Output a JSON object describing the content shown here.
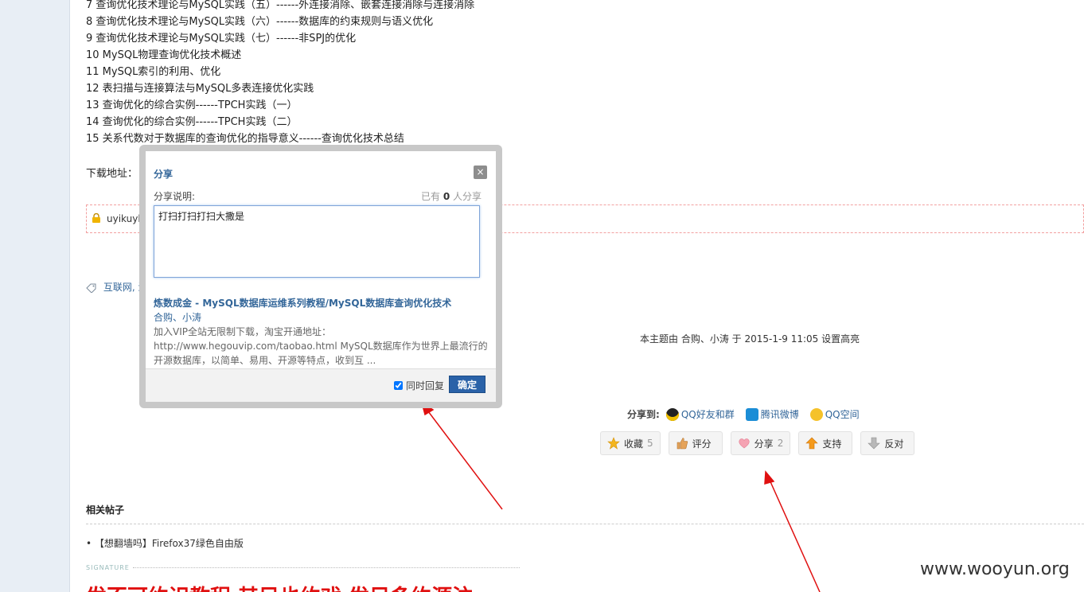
{
  "toc": [
    "7 查询优化技术理论与MySQL实践（五）------外连接消除、嵌套连接消除与连接消除",
    "8 查询优化技术理论与MySQL实践（六）------数据库的约束规则与语义优化",
    "9 查询优化技术理论与MySQL实践（七）------非SPJ的优化",
    "10 MySQL物理查询优化技术概述",
    "11 MySQL索引的利用、优化",
    "12 表扫描与连接算法与MySQL多表连接优化实践",
    "13 查询优化的综合实例------TPCH实践（一）",
    "14 查询优化的综合实例------TPCH实践（二）",
    "15 关系代数对于数据库的查询优化的指导意义------查询优化技术总结"
  ],
  "download_label": "下载地址：",
  "locked_text": "uyikuyk ,",
  "tags_text": "互联网, 淘",
  "highlight_note": "本主题由 合购、小涛 于 2015-1-9 11:05 设置高亮",
  "share_to": {
    "label": "分享到:",
    "links": [
      "QQ好友和群",
      "腾讯微博",
      "QQ空间"
    ]
  },
  "actions": [
    {
      "label": "收藏",
      "count": "5"
    },
    {
      "label": "评分",
      "count": ""
    },
    {
      "label": "分享",
      "count": "2"
    },
    {
      "label": "支持",
      "count": ""
    },
    {
      "label": "反对",
      "count": ""
    }
  ],
  "related": {
    "title": "相关帖子",
    "items": [
      "• 【想翻墙吗】Firefox37绿色自由版"
    ]
  },
  "signature_label": "SIGNATURE",
  "red_text": "发不可约识教程 其目也约戏 发目多约源注",
  "watermark": "www.wooyun.org",
  "modal": {
    "title": "分享",
    "close": "×",
    "desc_label": "分享说明:",
    "shared_prefix": "已有 ",
    "shared_count": "0",
    "shared_suffix": " 人分享",
    "desc_value": "打扫打扫打扫大撒是",
    "post_title": "炼数成金 - MySQL数据库运维系列教程/MySQL数据库查询优化技术",
    "post_author": "合购、小涛",
    "post_excerpt": "加入VIP全站无限制下载，淘宝开通地址：http://www.hegouvip.com/taobao.html MySQL数据库作为世界上最流行的开源数据库，以简单、易用、开源等特点，收到互 ...",
    "reply_label": "同时回复",
    "reply_checked": true,
    "confirm": "确定"
  },
  "colors": {
    "link": "#336699",
    "accent_button": "#2a62a8",
    "annotation_red": "#e01010"
  }
}
